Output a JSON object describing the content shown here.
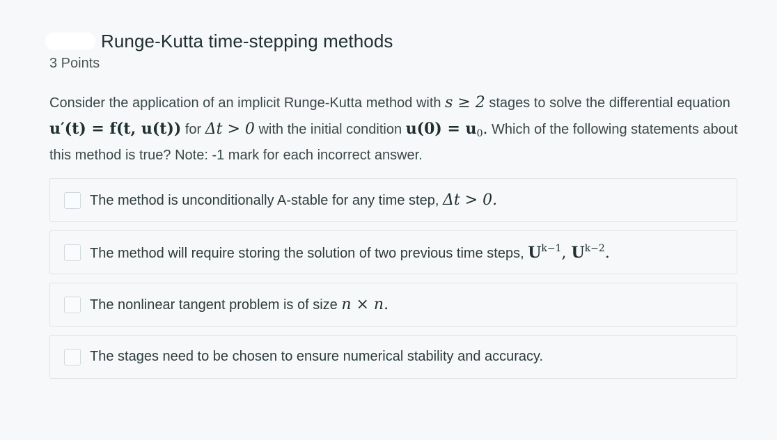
{
  "question": {
    "title": "Runge-Kutta time-stepping methods",
    "points": "3 Points",
    "prompt": {
      "p1": "Consider the application of an implicit Runge-Kutta method with ",
      "m1": "s ≥ 2",
      "p2": " stages to solve the differential equation ",
      "m2": "u′(t) = f(t, u(t))",
      "p3": " for ",
      "m3": "Δt > 0",
      "p4": " with the initial condition ",
      "m4": "u(0) = u",
      "m4_sub": "0",
      "m4_end": ".",
      "p5": " Which of the following statements about this method is true? Note: -1 mark for each incorrect answer."
    },
    "options": [
      {
        "text": "The method is unconditionally A-stable for any time step, ",
        "math": "Δt > 0.",
        "checked": false
      },
      {
        "text": "The method will require storing the solution of two previous time steps, ",
        "math_a": "U",
        "math_a_sup": "k−1",
        "math_sep": ", ",
        "math_b": "U",
        "math_b_sup": "k−2",
        "math_end": ".",
        "checked": false
      },
      {
        "text": "The nonlinear tangent problem is of size ",
        "math": "n × n.",
        "checked": false
      },
      {
        "text": "The stages need to be chosen to ensure numerical stability and accuracy.",
        "checked": false
      }
    ]
  }
}
